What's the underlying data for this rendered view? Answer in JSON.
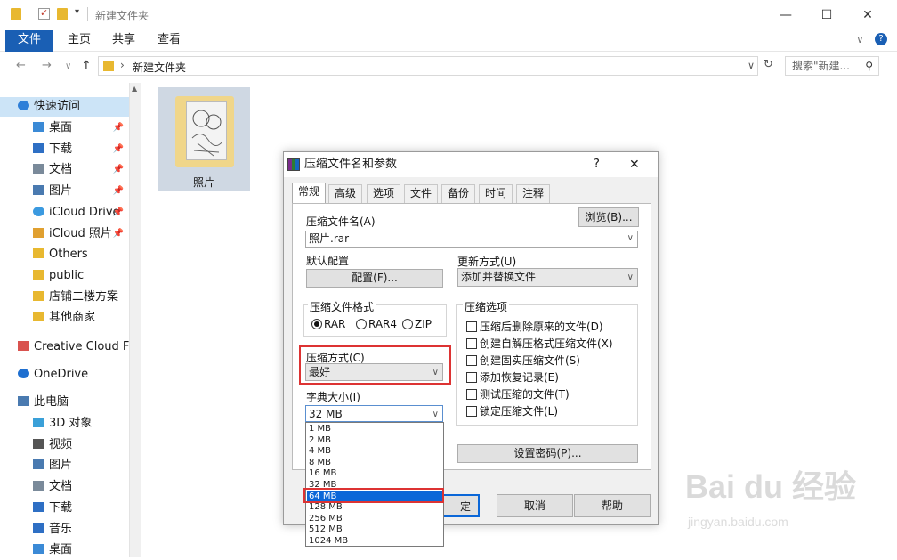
{
  "window": {
    "title": "新建文件夹",
    "minimize": "—",
    "maximize": "☐",
    "close": "✕"
  },
  "ribbon": {
    "tabs": [
      "文件",
      "主页",
      "共享",
      "查看"
    ],
    "expand": "∨",
    "help": "?"
  },
  "address": {
    "back": "←",
    "forward": "→",
    "recent": "∨",
    "up": "↑",
    "separator": "›",
    "path": "新建文件夹",
    "dropdown": "∨",
    "refresh": "↻",
    "search_placeholder": "搜索\"新建...",
    "search_icon": "⚲"
  },
  "sidebar": {
    "items": [
      {
        "label": "快速访问",
        "icon": "star-icon",
        "color": "#2e7fd8"
      },
      {
        "label": "桌面",
        "icon": "desktop-icon",
        "color": "#3b8ad6",
        "pinned": true
      },
      {
        "label": "下载",
        "icon": "download-icon",
        "color": "#2e6fc4",
        "pinned": true
      },
      {
        "label": "文档",
        "icon": "document-icon",
        "color": "#7a8a9a",
        "pinned": true
      },
      {
        "label": "图片",
        "icon": "pictures-icon",
        "color": "#4a7ab0",
        "pinned": true
      },
      {
        "label": "iCloud Drive",
        "icon": "icloud-icon",
        "color": "#3b9ae0",
        "pinned": true
      },
      {
        "label": "iCloud 照片",
        "icon": "icloud-photos-icon",
        "color": "#e0a030",
        "pinned": true
      },
      {
        "label": "Others",
        "icon": "folder-icon",
        "color": "#e8b830"
      },
      {
        "label": "public",
        "icon": "folder-icon",
        "color": "#e8b830"
      },
      {
        "label": "店铺二楼方案",
        "icon": "folder-icon",
        "color": "#e8b830"
      },
      {
        "label": "其他商家",
        "icon": "folder-icon",
        "color": "#e8b830"
      },
      {
        "label": "Creative Cloud F",
        "icon": "creative-cloud-icon",
        "color": "#d9534f"
      },
      {
        "label": "OneDrive",
        "icon": "onedrive-icon",
        "color": "#1e6fd0"
      },
      {
        "label": "此电脑",
        "icon": "computer-icon",
        "color": "#4a7ab0"
      },
      {
        "label": "3D 对象",
        "icon": "3d-objects-icon",
        "color": "#3aa0d8"
      },
      {
        "label": "视频",
        "icon": "video-icon",
        "color": "#555555"
      },
      {
        "label": "图片",
        "icon": "pictures-icon",
        "color": "#4a7ab0"
      },
      {
        "label": "文档",
        "icon": "document-icon",
        "color": "#7a8a9a"
      },
      {
        "label": "下载",
        "icon": "download-icon",
        "color": "#2e6fc4"
      },
      {
        "label": "音乐",
        "icon": "music-icon",
        "color": "#2e6fc4"
      },
      {
        "label": "桌面",
        "icon": "desktop-icon",
        "color": "#3b8ad6"
      }
    ],
    "pin_glyph": "📌",
    "scroll_up": "▲"
  },
  "content": {
    "folder_name": "照片"
  },
  "dialog": {
    "title": "压缩文件名和参数",
    "help": "?",
    "close": "✕",
    "tabs": [
      "常规",
      "高级",
      "选项",
      "文件",
      "备份",
      "时间",
      "注释"
    ],
    "archive_name_label": "压缩文件名(A)",
    "browse_button": "浏览(B)...",
    "archive_name_value": "照片.rar",
    "default_profile_label": "默认配置",
    "profile_button": "配置(F)...",
    "update_mode_label": "更新方式(U)",
    "update_mode_value": "添加并替换文件",
    "format_group_label": "压缩文件格式",
    "formats": [
      {
        "label": "RAR",
        "selected": true
      },
      {
        "label": "RAR4",
        "selected": false
      },
      {
        "label": "ZIP",
        "selected": false
      }
    ],
    "method_label": "压缩方式(C)",
    "method_value": "最好",
    "dict_label": "字典大小(I)",
    "dict_value": "32 MB",
    "options_group_label": "压缩选项",
    "options": [
      "压缩后删除原来的文件(D)",
      "创建自解压格式压缩文件(X)",
      "创建固实压缩文件(S)",
      "添加恢复记录(E)",
      "测试压缩的文件(T)",
      "锁定压缩文件(L)"
    ],
    "password_button": "设置密码(P)...",
    "ok_button": "确定",
    "ok_visible": "定",
    "cancel_button": "取消",
    "help_button": "帮助",
    "dict_options": [
      "1 MB",
      "2 MB",
      "4 MB",
      "8 MB",
      "16 MB",
      "32 MB",
      "64 MB",
      "128 MB",
      "256 MB",
      "512 MB",
      "1024 MB"
    ],
    "dict_selected": "64 MB",
    "highlight_color": "#d33333",
    "selection_color": "#0b67d8"
  },
  "watermark": {
    "brand": "Bai du 经验",
    "url": "jingyan.baidu.com"
  }
}
